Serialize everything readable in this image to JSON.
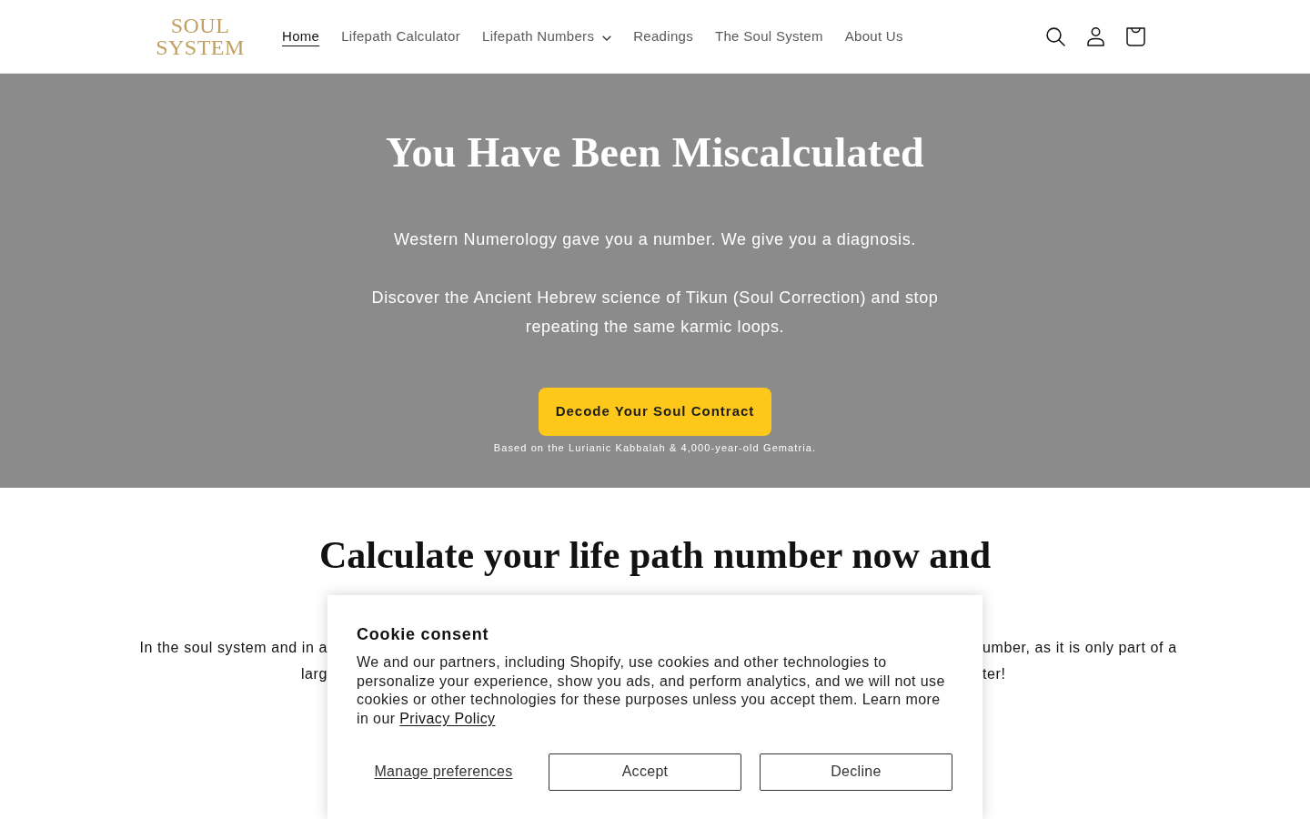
{
  "header": {
    "logo": {
      "line_1": "SOUL",
      "line_2": "SYSTEM"
    },
    "nav": [
      {
        "label": "Home",
        "selected": true,
        "dropdown": false
      },
      {
        "label": "Lifepath Calculator",
        "selected": false,
        "dropdown": false
      },
      {
        "label": "Lifepath Numbers",
        "selected": false,
        "dropdown": true
      },
      {
        "label": "Readings",
        "selected": false,
        "dropdown": false
      },
      {
        "label": "The Soul System",
        "selected": false,
        "dropdown": false
      },
      {
        "label": "About Us",
        "selected": false,
        "dropdown": false
      }
    ]
  },
  "hero": {
    "title": "You Have Been Miscalculated",
    "paragraphs": [
      "Western Numerology gave you a number. We give you a diagnosis.",
      "Discover the Ancient Hebrew science of Tikun (Soul Correction) and stop repeating the same karmic loops."
    ],
    "button": "Decode Your Soul Contract",
    "caption": "Based on the Lurianic Kabbalah & 4,000-year-old Gematria."
  },
  "calculator_section": {
    "heading": "Calculate your life path number now and",
    "text_lines": [
      {
        "left": "In the soul system and in a",
        "right": "umber, as it is only part of a"
      },
      {
        "left": "larg",
        "right": "ter!"
      }
    ]
  },
  "cookie_banner": {
    "title": "Cookie consent",
    "text": "We and our partners, including Shopify, use cookies and other technologies to personalize your experience, show you ads, and perform analytics, and we will not use cookies or other technologies for these purposes unless you accept them. Learn more in our",
    "link": "Privacy Policy",
    "buttons": [
      {
        "label": "Manage preferences",
        "kind": "link"
      },
      {
        "label": "Accept",
        "kind": "outline"
      },
      {
        "label": "Decline",
        "kind": "outline"
      }
    ]
  }
}
